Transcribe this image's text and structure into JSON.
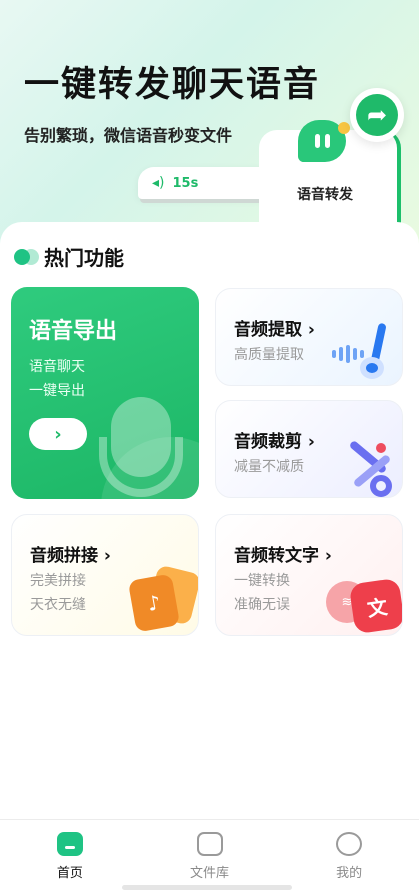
{
  "hero": {
    "title": "一键转发聊天语音",
    "subtitle": "告别繁琐，微信语音秒变文件",
    "voice_duration": "15s",
    "forward_label": "语音转发"
  },
  "section": {
    "title": "热门功能"
  },
  "features": {
    "export": {
      "title": "语音导出",
      "desc": "语音聊天\n一键导出"
    },
    "extract": {
      "title": "音频提取 ›",
      "desc": "高质量提取"
    },
    "cut": {
      "title": "音频裁剪 ›",
      "desc": "减量不减质"
    },
    "join": {
      "title": "音频拼接 ›",
      "desc": "完美拼接\n天衣无缝"
    },
    "to_text": {
      "title": "音频转文字 ›",
      "desc": "一键转换\n准确无误",
      "glyph": "文"
    }
  },
  "tabbar": {
    "items": [
      {
        "label": "首页",
        "icon": "home-icon",
        "active": true
      },
      {
        "label": "文件库",
        "icon": "folder-icon",
        "active": false
      },
      {
        "label": "我的",
        "icon": "smile-icon",
        "active": false
      }
    ]
  },
  "colors": {
    "accent": "#1fc384",
    "primary_green": "#1fba6a"
  }
}
